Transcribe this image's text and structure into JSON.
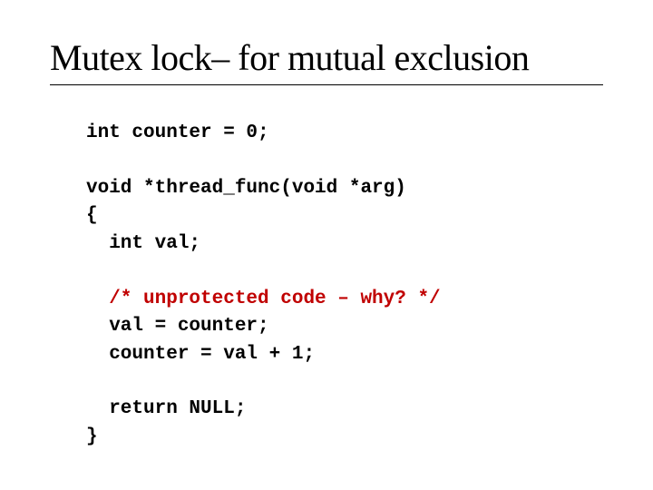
{
  "title": "Mutex lock– for mutual exclusion",
  "code": {
    "line1": "int counter = 0;",
    "line2": "",
    "line3": "void *thread_func(void *arg)",
    "line4": "{",
    "line5": "  int val;",
    "line6": "",
    "line7_comment": "  /* unprotected code – why? */",
    "line8": "  val = counter;",
    "line9": "  counter = val + 1;",
    "line10": "",
    "line11": "  return NULL;",
    "line12": "}"
  }
}
